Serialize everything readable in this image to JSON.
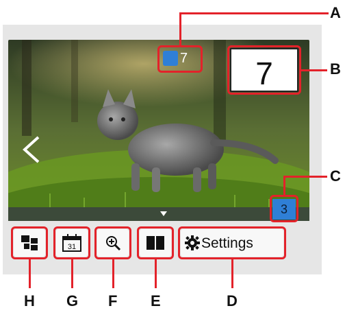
{
  "screen": {
    "copies_value": "7",
    "photo_count_label": "7",
    "sheet_number": "3",
    "settings_label": "Settings",
    "calendar_day": "31"
  },
  "callouts": {
    "a": "A",
    "b": "B",
    "c": "C",
    "d": "D",
    "e": "E",
    "f": "F",
    "g": "G",
    "h": "H"
  },
  "icons": {
    "prev_photo": "chevron-left-icon",
    "scroll_indicator": "triangle-down-icon",
    "index_view": "index-layout-icon",
    "date_search": "calendar-icon",
    "zoom": "zoom-in-icon",
    "two_up_view": "split-view-icon",
    "settings": "gear-icon"
  },
  "colors": {
    "callout_red": "#e3222a",
    "badge_blue": "#2f7fd6"
  }
}
